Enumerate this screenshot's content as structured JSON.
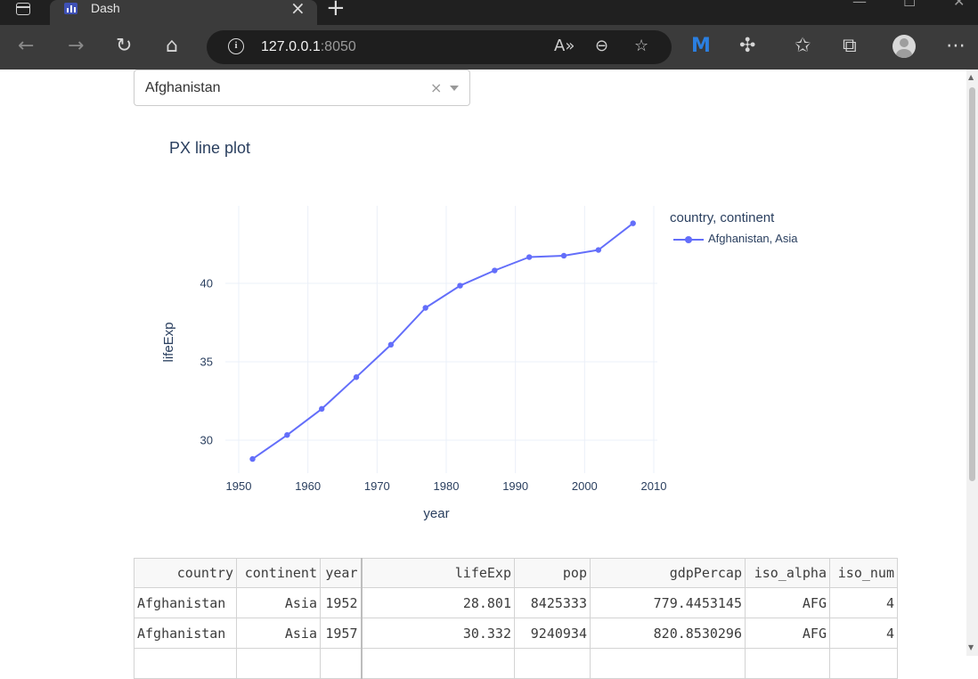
{
  "browser": {
    "tab_title": "Dash",
    "tab_close": "×",
    "new_tab": "+",
    "url_host": "127.0.0.1",
    "url_port": ":8050",
    "icons": [
      "back-icon",
      "forward-icon",
      "refresh-icon",
      "home-icon",
      "site-info-icon",
      "read-aloud-icon",
      "zoom-out-icon",
      "add-favorite-icon",
      "malwarebytes-icon",
      "extensions-icon",
      "favorites-icon",
      "collections-icon",
      "profile-avatar",
      "more-icon"
    ]
  },
  "dropdown": {
    "value": "Afghanistan",
    "clear_label": "×"
  },
  "plot": {
    "title": "PX line plot",
    "legend_title": "country, continent",
    "line_color": "#636efa"
  },
  "chart_data": {
    "type": "line",
    "title": "PX line plot",
    "xlabel": "year",
    "ylabel": "lifeExp",
    "xlim": [
      1950,
      2010
    ],
    "ylim": [
      28,
      45
    ],
    "xticks": [
      1950,
      1960,
      1970,
      1980,
      1990,
      2000,
      2010
    ],
    "yticks": [
      30,
      35,
      40
    ],
    "grid": true,
    "legend": "top-right",
    "series": [
      {
        "name": "Afghanistan, Asia",
        "color": "#636efa",
        "x": [
          1952,
          1957,
          1962,
          1967,
          1972,
          1977,
          1982,
          1987,
          1992,
          1997,
          2002,
          2007
        ],
        "y": [
          28.801,
          30.332,
          31.997,
          34.02,
          36.088,
          38.438,
          39.854,
          40.822,
          41.674,
          41.763,
          42.129,
          43.828
        ]
      }
    ]
  },
  "table": {
    "headers": [
      "country",
      "continent",
      "year",
      "lifeExp",
      "pop",
      "gdpPercap",
      "iso_alpha",
      "iso_num"
    ],
    "rows": [
      [
        "Afghanistan",
        "Asia",
        "1952",
        "28.801",
        "8425333",
        "779.4453145",
        "AFG",
        "4"
      ],
      [
        "Afghanistan",
        "Asia",
        "1957",
        "30.332",
        "9240934",
        "820.8530296",
        "AFG",
        "4"
      ]
    ]
  }
}
